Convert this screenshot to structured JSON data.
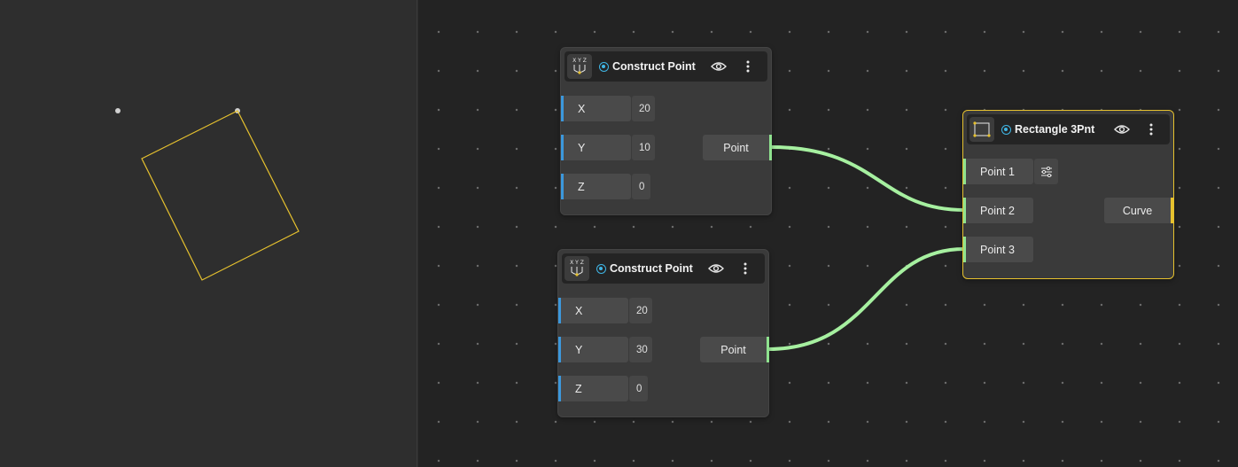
{
  "viewport": {
    "shape_color": "#e6c12e",
    "point_color": "#d0d0d0"
  },
  "nodes": {
    "construct_point_1": {
      "title": "Construct Point",
      "icon_text": "X Y Z",
      "inputs": [
        {
          "label": "X",
          "value": "20"
        },
        {
          "label": "Y",
          "value": "10"
        },
        {
          "label": "Z",
          "value": "0"
        }
      ],
      "output": "Point"
    },
    "construct_point_2": {
      "title": "Construct Point",
      "icon_text": "X Y Z",
      "inputs": [
        {
          "label": "X",
          "value": "20"
        },
        {
          "label": "Y",
          "value": "30"
        },
        {
          "label": "Z",
          "value": "0"
        }
      ],
      "output": "Point"
    },
    "rectangle_3pnt": {
      "title": "Rectangle 3Pnt",
      "inputs": [
        {
          "label": "Point 1"
        },
        {
          "label": "Point 2"
        },
        {
          "label": "Point 3"
        }
      ],
      "output": "Curve"
    }
  },
  "colors": {
    "wire": "#a6f0a0",
    "input_accent": "#3c98dc",
    "selection": "#e6c12e",
    "status": "#3fb6e6"
  }
}
